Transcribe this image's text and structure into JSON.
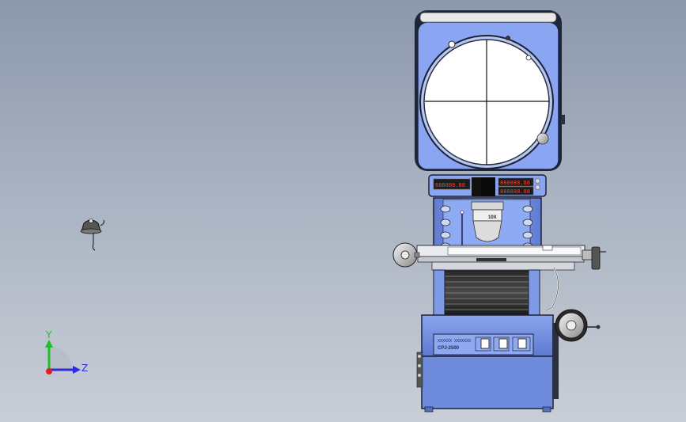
{
  "model": {
    "display_readouts": [
      "888888.88",
      "888888.88",
      "888888.88"
    ],
    "lens_label": "10X",
    "panel_maker": "XXXXXX XXXXXXX",
    "panel_model": "CPJ-2500"
  },
  "triad": {
    "y_label": "Y",
    "z_label": "Z",
    "y_color": "#1fbf2a",
    "z_color": "#2a2adf",
    "origin_color": "#e02020"
  },
  "colors": {
    "body_blue": "#7f9be8",
    "panel_blue": "#6f8fdc",
    "dark_frame": "#1c2236",
    "led_red": "#ff3a2a"
  }
}
